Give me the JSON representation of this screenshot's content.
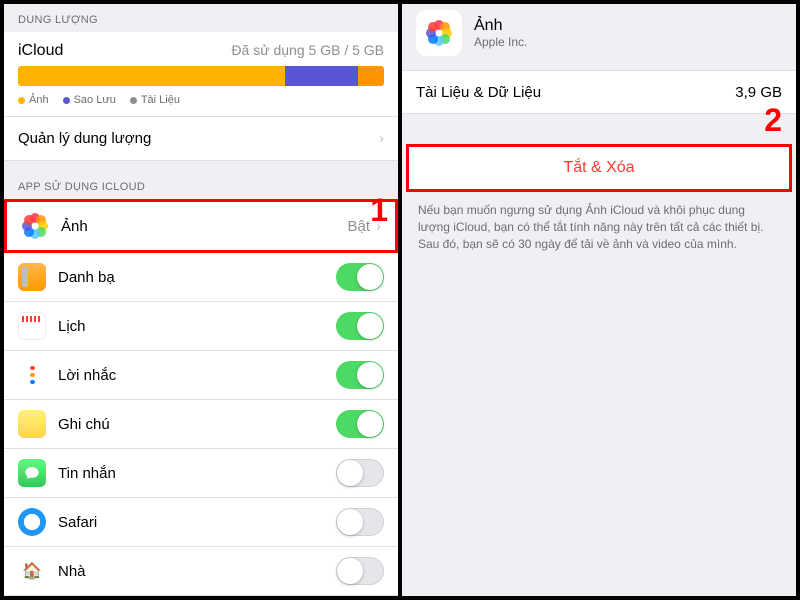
{
  "left": {
    "storage_header": "DUNG LƯỢNG",
    "storage_title": "iCloud",
    "storage_used": "Đã sử dụng 5 GB / 5 GB",
    "segments": [
      {
        "color": "#ffb300",
        "pct": 73
      },
      {
        "color": "#5856d6",
        "pct": 20
      },
      {
        "color": "#ff9500",
        "pct": 7
      }
    ],
    "legend": [
      {
        "color": "#ffb300",
        "label": "Ảnh"
      },
      {
        "color": "#5856d6",
        "label": "Sao Lưu"
      },
      {
        "color": "#8e8e93",
        "label": "Tài Liệu"
      }
    ],
    "manage_label": "Quản lý dung lượng",
    "apps_header": "APP SỬ DỤNG ICLOUD",
    "photos_row": {
      "label": "Ảnh",
      "value": "Bật"
    },
    "apps": [
      {
        "id": "contacts",
        "label": "Danh bạ",
        "on": true
      },
      {
        "id": "calendar",
        "label": "Lịch",
        "on": true
      },
      {
        "id": "reminders",
        "label": "Lời nhắc",
        "on": true
      },
      {
        "id": "notes",
        "label": "Ghi chú",
        "on": true
      },
      {
        "id": "messages",
        "label": "Tin nhắn",
        "on": false
      },
      {
        "id": "safari",
        "label": "Safari",
        "on": false
      },
      {
        "id": "home",
        "label": "Nhà",
        "on": false
      }
    ]
  },
  "right": {
    "app_name": "Ảnh",
    "vendor": "Apple Inc.",
    "data_label": "Tài Liệu & Dữ Liệu",
    "data_value": "3,9 GB",
    "action_label": "Tắt & Xóa",
    "note": "Nếu bạn muốn ngưng sử dụng Ảnh iCloud và khôi phục dung lượng iCloud, bạn có thể tắt tính năng này trên tất cả các thiết bị. Sau đó, bạn sẽ có 30 ngày để tải về ảnh và video của mình."
  },
  "markers": {
    "one": "1",
    "two": "2"
  }
}
